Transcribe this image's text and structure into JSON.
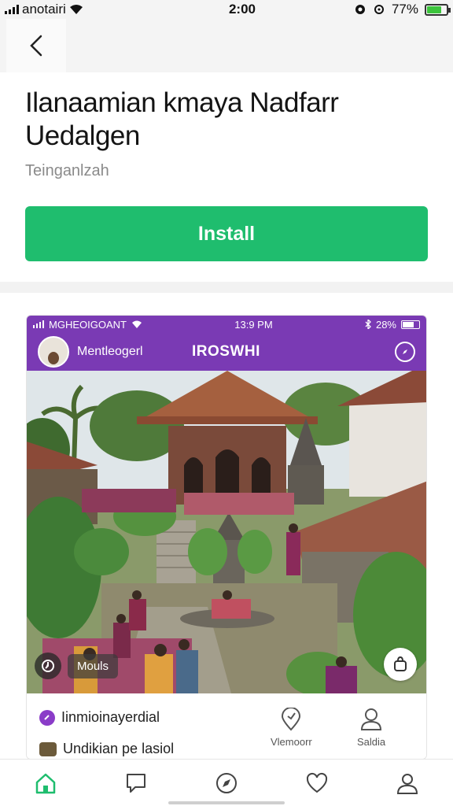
{
  "status_bar": {
    "carrier": "anotairi",
    "time": "2:00",
    "battery_percent": "77%",
    "battery_level": 0.77
  },
  "app": {
    "title": "Ilanaamian kmaya Nadfarr Uedalgen",
    "subtitle": "Teinganlzah",
    "install_label": "Install",
    "install_color": "#1fbd6e"
  },
  "preview": {
    "status": {
      "left": "MGHEOIGOANT",
      "time": "13:9 PM",
      "right": "28%"
    },
    "header": {
      "user_name": "Mentleogerl",
      "brand": "IROSWHI",
      "color": "#7a3ab4"
    },
    "media_label": "Mouls",
    "info": {
      "row1": "Iinmioinayerdial",
      "row2": "Undikian pe lasiol",
      "actions": [
        {
          "label": "Vlemoorr",
          "icon": "location-pin-icon"
        },
        {
          "label": "Saldia",
          "icon": "person-icon"
        }
      ]
    }
  },
  "bottom_nav": {
    "items": [
      {
        "icon": "home-icon",
        "active": true
      },
      {
        "icon": "chat-icon",
        "active": false
      },
      {
        "icon": "compass-icon",
        "active": false
      },
      {
        "icon": "heart-icon",
        "active": false
      },
      {
        "icon": "profile-icon",
        "active": false
      }
    ],
    "active_color": "#1fbd6e"
  }
}
